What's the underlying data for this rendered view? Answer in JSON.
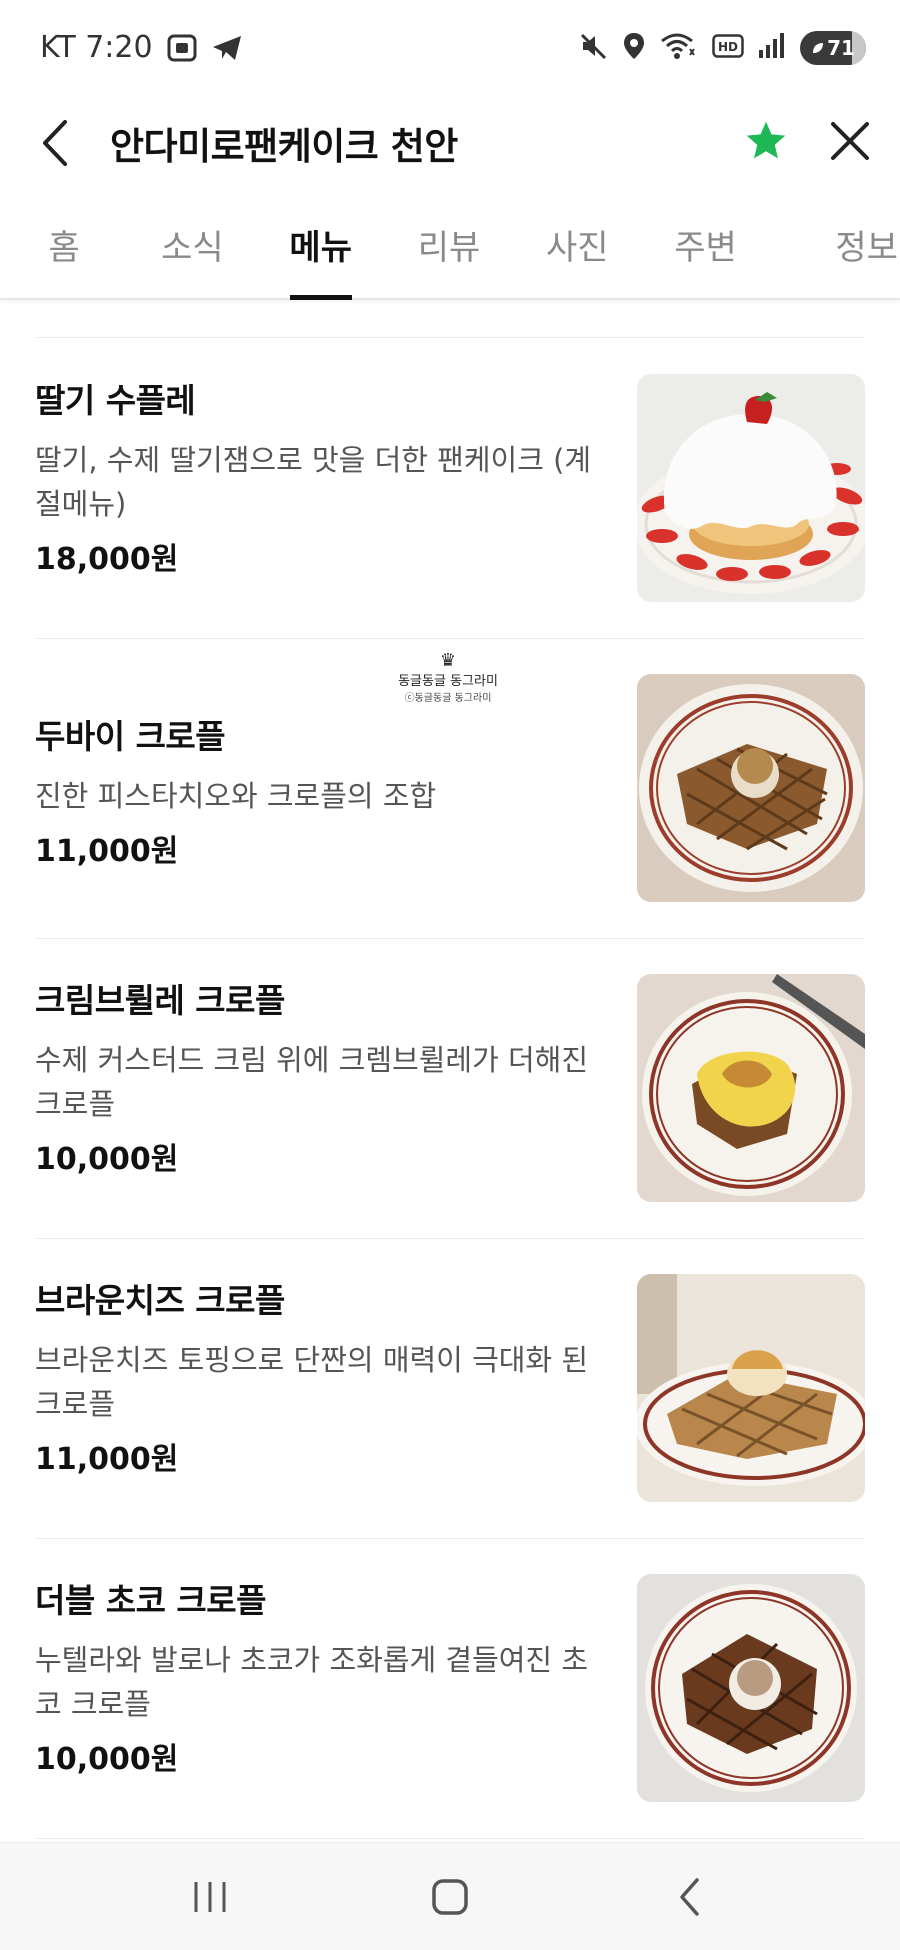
{
  "status_bar": {
    "carrier_time": "KT 7:20",
    "battery": "71"
  },
  "header": {
    "title": "안다미로팬케이크 천안",
    "star_color": "#1eb955"
  },
  "tabs": [
    {
      "label": "홈",
      "active": false
    },
    {
      "label": "소식",
      "active": false
    },
    {
      "label": "메뉴",
      "active": true
    },
    {
      "label": "리뷰",
      "active": false
    },
    {
      "label": "사진",
      "active": false
    },
    {
      "label": "주변",
      "active": false
    },
    {
      "label": "정보",
      "active": false
    }
  ],
  "menu_items": [
    {
      "name": "딸기 수플레",
      "desc": "딸기, 수제 딸기잼으로 맛을 더한 팬케이크 (계절메뉴)",
      "price": "18,000원",
      "photo": "strawberry-souffle-pancake"
    },
    {
      "name": "두바이 크로플",
      "desc": "진한 피스타치오와 크로플의 조합",
      "price": "11,000원",
      "photo": "dubai-croffle"
    },
    {
      "name": "크림브륄레 크로플",
      "desc": "수제 커스터드 크림 위에 크렘브륄레가 더해진 크로플",
      "price": "10,000원",
      "photo": "creme-brulee-croffle"
    },
    {
      "name": "브라운치즈 크로플",
      "desc": "브라운치즈 토핑으로 단짠의 매력이 극대화 된 크로플",
      "price": "11,000원",
      "photo": "brown-cheese-croffle"
    },
    {
      "name": "더블 초코 크로플",
      "desc": "누텔라와 발로나 초코가 조화롭게 곁들여진 초코 크로플",
      "price": "10,000원",
      "photo": "double-choco-croffle"
    }
  ],
  "watermark": {
    "line1": "동글동글 동그라미",
    "line2": "ⓒ동글동글 동그라미"
  }
}
